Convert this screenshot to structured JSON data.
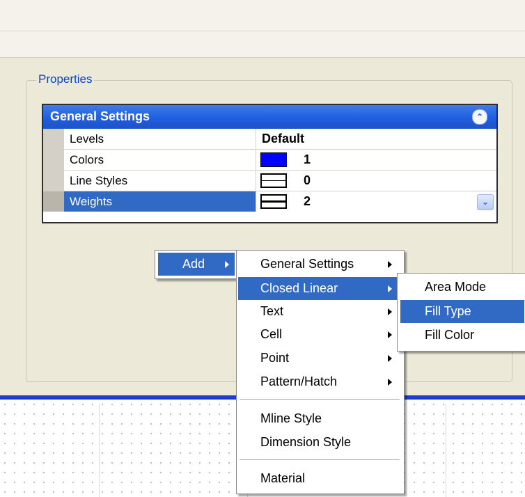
{
  "group": {
    "title": "Properties"
  },
  "grid": {
    "header": "General Settings",
    "rows": [
      {
        "label": "Levels",
        "value": "Default",
        "icon": "none"
      },
      {
        "label": "Colors",
        "value": "1",
        "icon": "color-swatch",
        "color": "#0000ff"
      },
      {
        "label": "Line Styles",
        "value": "0",
        "icon": "line-style-swatch"
      },
      {
        "label": "Weights",
        "value": "2",
        "icon": "line-weight-swatch",
        "selected": true
      }
    ]
  },
  "colors": {
    "accent": "#316ac5",
    "header": "#215ee0",
    "canvas_border": "#1a3fd0"
  },
  "menu_add": {
    "label": "Add"
  },
  "menu_main": {
    "items": [
      {
        "label": "General Settings",
        "submenu": true
      },
      {
        "label": "Closed Linear",
        "submenu": true,
        "highlighted": true
      },
      {
        "label": "Text",
        "submenu": true
      },
      {
        "label": "Cell",
        "submenu": true
      },
      {
        "label": "Point",
        "submenu": true
      },
      {
        "label": "Pattern/Hatch",
        "submenu": true
      },
      {
        "label": "Mline Style"
      },
      {
        "label": "Dimension Style"
      },
      {
        "label": "Material"
      }
    ]
  },
  "menu_sub": {
    "items": [
      {
        "label": "Area Mode"
      },
      {
        "label": "Fill Type",
        "highlighted": true
      },
      {
        "label": "Fill Color"
      }
    ]
  }
}
